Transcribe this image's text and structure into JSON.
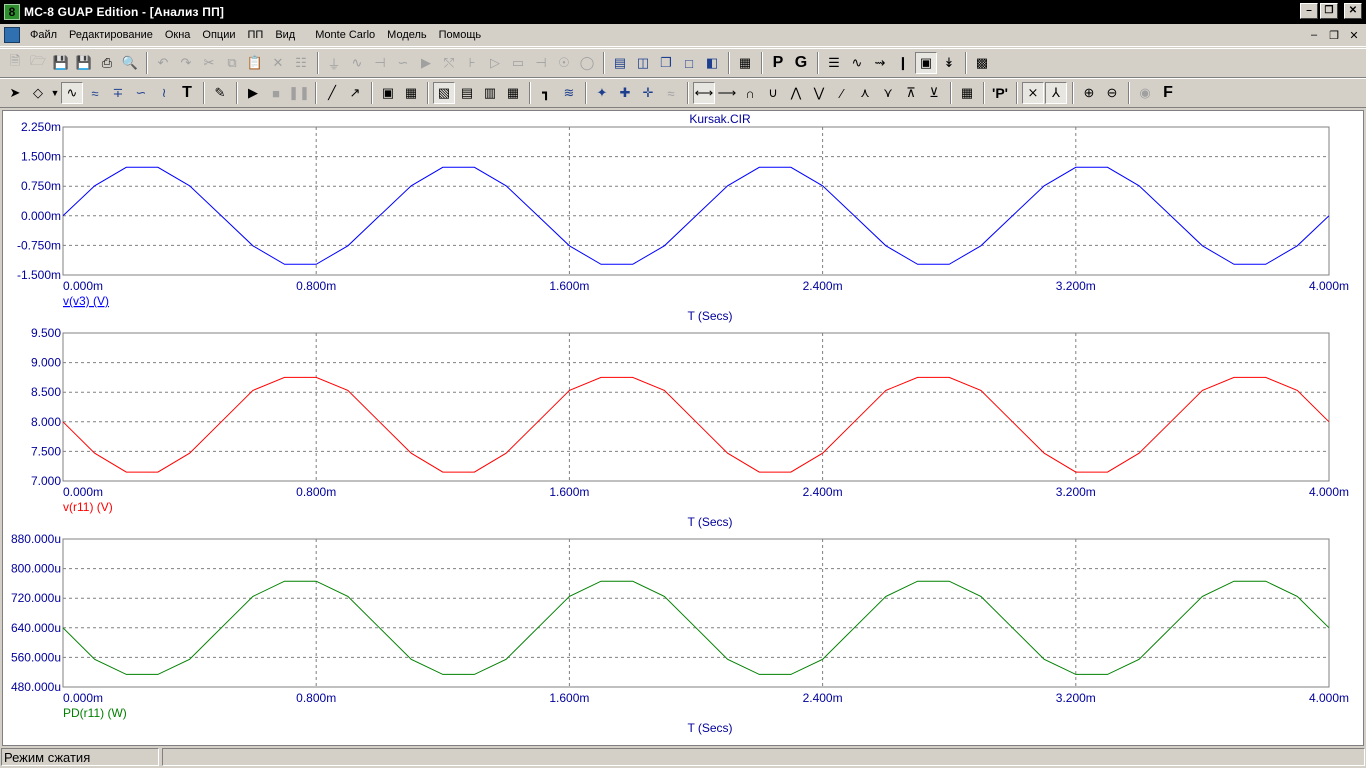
{
  "window": {
    "title": "MC-8 GUAP Edition - [Анализ ПП]",
    "app_icon_glyph": "8"
  },
  "menu": {
    "items": [
      "Файл",
      "Редактирование",
      "Окна",
      "Опции",
      "ПП",
      "Вид",
      "Monte Carlo",
      "Модель",
      "Помощь"
    ]
  },
  "toolbar2": {
    "text_tool": "T",
    "p_label": "P",
    "g_label": "G",
    "p_quote_label": "'P'",
    "f_label": "F"
  },
  "status": {
    "mode": "Режим сжатия",
    "second": ""
  },
  "colors": {
    "v3": "#0000ff",
    "r11": "#ff0000",
    "pd": "#008000",
    "axis_text": "#00009c",
    "grid": "#808080"
  },
  "chart_data": [
    {
      "type": "line",
      "title": "Kursak.CIR",
      "xlabel": "T (Secs)",
      "xlim": [
        0,
        4.0
      ],
      "x_ticks": [
        "0.000m",
        "0.800m",
        "1.600m",
        "2.400m",
        "3.200m",
        "4.000m"
      ],
      "ylim": [
        -1.5,
        2.25
      ],
      "y_ticks": [
        "2.250m",
        "1.500m",
        "0.750m",
        "0.000m",
        "-0.750m",
        "-1.500m"
      ],
      "grid": true,
      "series": [
        {
          "name": "v(v3) (V)",
          "color": "#0000ff",
          "x": [
            0.0,
            0.1,
            0.2,
            0.3,
            0.4,
            0.5,
            0.6,
            0.7,
            0.8,
            0.9,
            1.0,
            1.1,
            1.2,
            1.3,
            1.4,
            1.5,
            1.6,
            1.7,
            1.8,
            1.9,
            2.0,
            2.1,
            2.2,
            2.3,
            2.4,
            2.5,
            2.6,
            2.7,
            2.8,
            2.9,
            3.0,
            3.1,
            3.2,
            3.3,
            3.4,
            3.5,
            3.6,
            3.7,
            3.8,
            3.9,
            4.0
          ],
          "values": [
            0.0,
            0.76,
            1.23,
            1.23,
            0.76,
            0.0,
            -0.76,
            -1.23,
            -1.23,
            -0.76,
            0.0,
            0.76,
            1.23,
            1.23,
            0.76,
            0.0,
            -0.76,
            -1.23,
            -1.23,
            -0.76,
            0.0,
            0.76,
            1.23,
            1.23,
            0.76,
            0.0,
            -0.76,
            -1.23,
            -1.23,
            -0.76,
            0.0,
            0.76,
            1.23,
            1.23,
            0.76,
            0.0,
            -0.76,
            -1.23,
            -1.23,
            -0.76,
            0.0
          ]
        }
      ]
    },
    {
      "type": "line",
      "title": "",
      "xlabel": "T (Secs)",
      "xlim": [
        0,
        4.0
      ],
      "x_ticks": [
        "0.000m",
        "0.800m",
        "1.600m",
        "2.400m",
        "3.200m",
        "4.000m"
      ],
      "ylim": [
        7.0,
        9.5
      ],
      "y_ticks": [
        "9.500",
        "9.000",
        "8.500",
        "8.000",
        "7.500",
        "7.000"
      ],
      "grid": true,
      "series": [
        {
          "name": "v(r11) (V)",
          "color": "#ff0000",
          "x": [
            0.0,
            0.1,
            0.2,
            0.3,
            0.4,
            0.5,
            0.6,
            0.7,
            0.8,
            0.9,
            1.0,
            1.1,
            1.2,
            1.3,
            1.4,
            1.5,
            1.6,
            1.7,
            1.8,
            1.9,
            2.0,
            2.1,
            2.2,
            2.3,
            2.4,
            2.5,
            2.6,
            2.7,
            2.8,
            2.9,
            3.0,
            3.1,
            3.2,
            3.3,
            3.4,
            3.5,
            3.6,
            3.7,
            3.8,
            3.9,
            4.0
          ],
          "values": [
            8.0,
            7.47,
            7.15,
            7.15,
            7.47,
            8.0,
            8.53,
            8.75,
            8.75,
            8.53,
            8.0,
            7.47,
            7.15,
            7.15,
            7.47,
            8.0,
            8.53,
            8.75,
            8.75,
            8.53,
            8.0,
            7.47,
            7.15,
            7.15,
            7.47,
            8.0,
            8.53,
            8.75,
            8.75,
            8.53,
            8.0,
            7.47,
            7.15,
            7.15,
            7.47,
            8.0,
            8.53,
            8.75,
            8.75,
            8.53,
            8.0
          ]
        }
      ]
    },
    {
      "type": "line",
      "title": "",
      "xlabel": "T (Secs)",
      "xlim": [
        0,
        4.0
      ],
      "x_ticks": [
        "0.000m",
        "0.800m",
        "1.600m",
        "2.400m",
        "3.200m",
        "4.000m"
      ],
      "ylim": [
        480,
        880
      ],
      "y_ticks": [
        "880.000u",
        "800.000u",
        "720.000u",
        "640.000u",
        "560.000u",
        "480.000u"
      ],
      "grid": true,
      "series": [
        {
          "name": "PD(r11) (W)",
          "color": "#008000",
          "x": [
            0.0,
            0.1,
            0.2,
            0.3,
            0.4,
            0.5,
            0.6,
            0.7,
            0.8,
            0.9,
            1.0,
            1.1,
            1.2,
            1.3,
            1.4,
            1.5,
            1.6,
            1.7,
            1.8,
            1.9,
            2.0,
            2.1,
            2.2,
            2.3,
            2.4,
            2.5,
            2.6,
            2.7,
            2.8,
            2.9,
            3.0,
            3.1,
            3.2,
            3.3,
            3.4,
            3.5,
            3.6,
            3.7,
            3.8,
            3.9,
            4.0
          ],
          "values": [
            640,
            555,
            514,
            514,
            555,
            640,
            725,
            766,
            766,
            725,
            640,
            555,
            514,
            514,
            555,
            640,
            725,
            766,
            766,
            725,
            640,
            555,
            514,
            514,
            555,
            640,
            725,
            766,
            766,
            725,
            640,
            555,
            514,
            514,
            555,
            640,
            725,
            766,
            766,
            725,
            640
          ]
        }
      ]
    }
  ]
}
